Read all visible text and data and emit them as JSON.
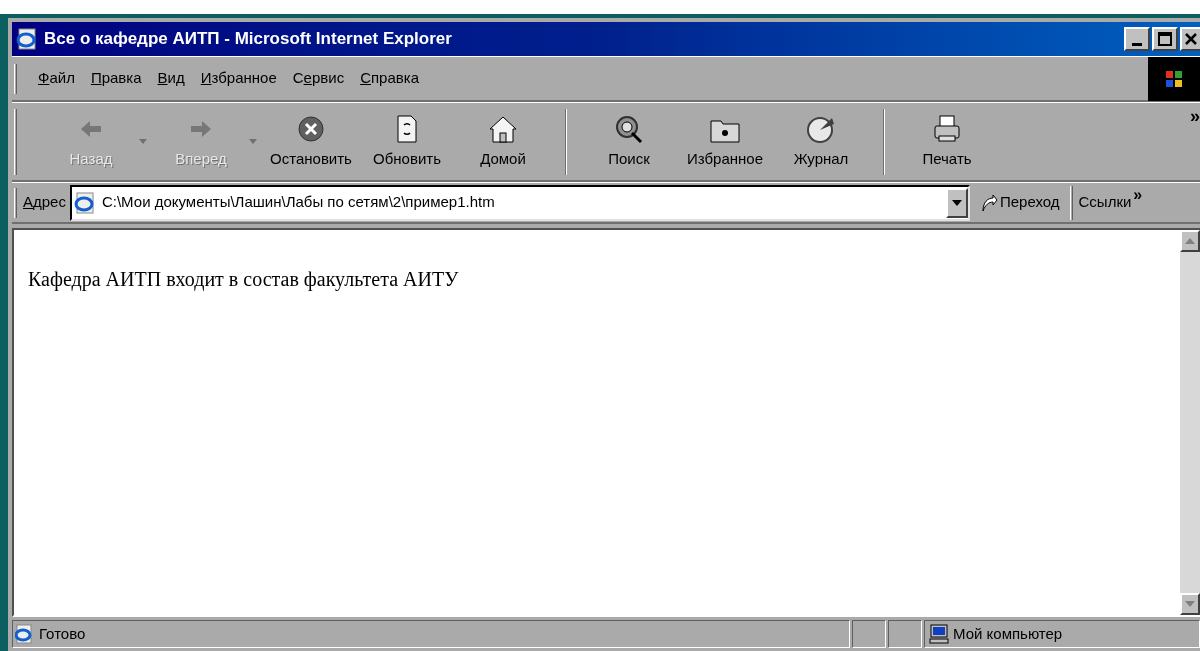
{
  "window": {
    "title": "Все о кафедре АИТП - Microsoft Internet Explorer"
  },
  "menu": [
    {
      "key": "Ф",
      "after": "айл"
    },
    {
      "key": "П",
      "after": "равка"
    },
    {
      "key": "В",
      "after": "ид"
    },
    {
      "key": "И",
      "after": "збранное"
    },
    {
      "before": "С",
      "key": "е",
      "after": "рвис"
    },
    {
      "key": "С",
      "after": "правка"
    }
  ],
  "toolbar_groups": [
    [
      {
        "label": "Назад",
        "disabled": true,
        "has_dropdown": true
      },
      {
        "label": "Вперед",
        "disabled": true,
        "has_dropdown": true
      },
      {
        "label": "Остановить",
        "disabled": false,
        "has_dropdown": false
      },
      {
        "label": "Обновить",
        "disabled": false,
        "has_dropdown": false
      },
      {
        "label": "Домой",
        "disabled": false,
        "has_dropdown": false
      }
    ],
    [
      {
        "label": "Поиск",
        "disabled": false,
        "has_dropdown": false
      },
      {
        "label": "Избранное",
        "disabled": false,
        "has_dropdown": false
      },
      {
        "label": "Журнал",
        "disabled": false,
        "has_dropdown": false
      }
    ],
    [
      {
        "label": "Печать",
        "disabled": false,
        "has_dropdown": false
      }
    ]
  ],
  "toolbar_more": "»",
  "address_bar": {
    "label": {
      "key": "А",
      "after": "дрес"
    },
    "value": "C:\\Мои документы\\Лашин\\Лабы по сетям\\2\\пример1.htm",
    "go_button": "Переход",
    "links": "Ссылки",
    "links_more": "»"
  },
  "page": {
    "text": "Кафедра АИТП входит в состав факультета АИТУ"
  },
  "status_bar": {
    "text": "Готово",
    "zone": "Мой компьютер"
  }
}
